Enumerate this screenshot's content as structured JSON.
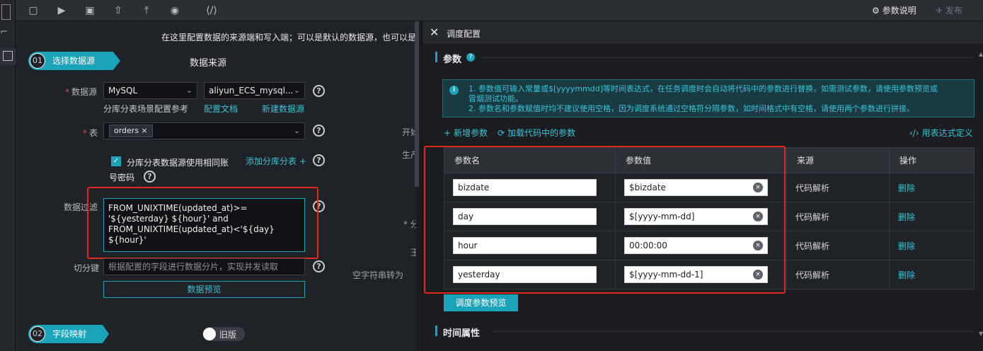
{
  "toolbar": {
    "params_doc": "参数说明",
    "publish": "发布"
  },
  "left": {
    "hint": "在这里配置数据的来源端和写入端；可以是默认的数据源，也可以是",
    "step1": {
      "num": "01",
      "label": "选择数据源"
    },
    "section_title": "数据来源",
    "datasource_label": "数据源",
    "datasource_type": "MySQL",
    "datasource_name": "aliyun_ECS_mysql...",
    "link_sharding_ref": "分库分表场景配置参考",
    "link_config_doc": "配置文档",
    "link_new_ds": "新建数据源",
    "table_label": "表",
    "table_tag": "orders",
    "checkbox_label_1": "分库分表数据源使用相同账",
    "checkbox_label_2": "号密码",
    "add_shard": "添加分库分表 +",
    "filter_label": "数据过滤",
    "filter_value": "FROM_UNIXTIME(updated_at)>=\n'${yesterday} ${hour}' and\nFROM_UNIXTIME(updated_at)<'${day}\n${hour}'",
    "split_label": "切分键",
    "split_placeholder": "根据配置的字段进行数据分片，实现并发读取",
    "preview_btn": "数据预览",
    "step2": {
      "num": "02",
      "label": "字段映射"
    },
    "old_version": "旧版",
    "peek_1": "开始",
    "peek_2": "生产",
    "peek_3": "空字符串转为",
    "peek_4": "* 分",
    "peek_5": "王"
  },
  "right": {
    "title": "调度配置",
    "params_section": "参数",
    "info_line1": "1. 参数值可输入常量或$[yyyymmdd]等时间表达式，在任务调度时会自动将代码中的参数进行替换，如需测试参数，请使用参数预览或",
    "info_line1b": "冒烟测试功能。",
    "info_line2": "2. 参数名和参数赋值时均不建议使用空格，因为调度系统通过空格符分隔参数，如时间格式中有空格，请使用两个参数进行拼接。",
    "add_param": "新增参数",
    "load_params": "加载代码中的参数",
    "expr_def": "用表达式定义",
    "columns": [
      "参数名",
      "参数值",
      "来源",
      "操作"
    ],
    "rows": [
      {
        "name": "bizdate",
        "value": "$bizdate",
        "source": "代码解析",
        "op": "删除"
      },
      {
        "name": "day",
        "value": "$[yyyy-mm-dd]",
        "source": "代码解析",
        "op": "删除"
      },
      {
        "name": "hour",
        "value": "00:00:00",
        "source": "代码解析",
        "op": "删除"
      },
      {
        "name": "yesterday",
        "value": "$[yyyy-mm-dd-1]",
        "source": "代码解析",
        "op": "删除"
      }
    ],
    "preview_btn": "调度参数预览",
    "time_section": "时间属性"
  }
}
